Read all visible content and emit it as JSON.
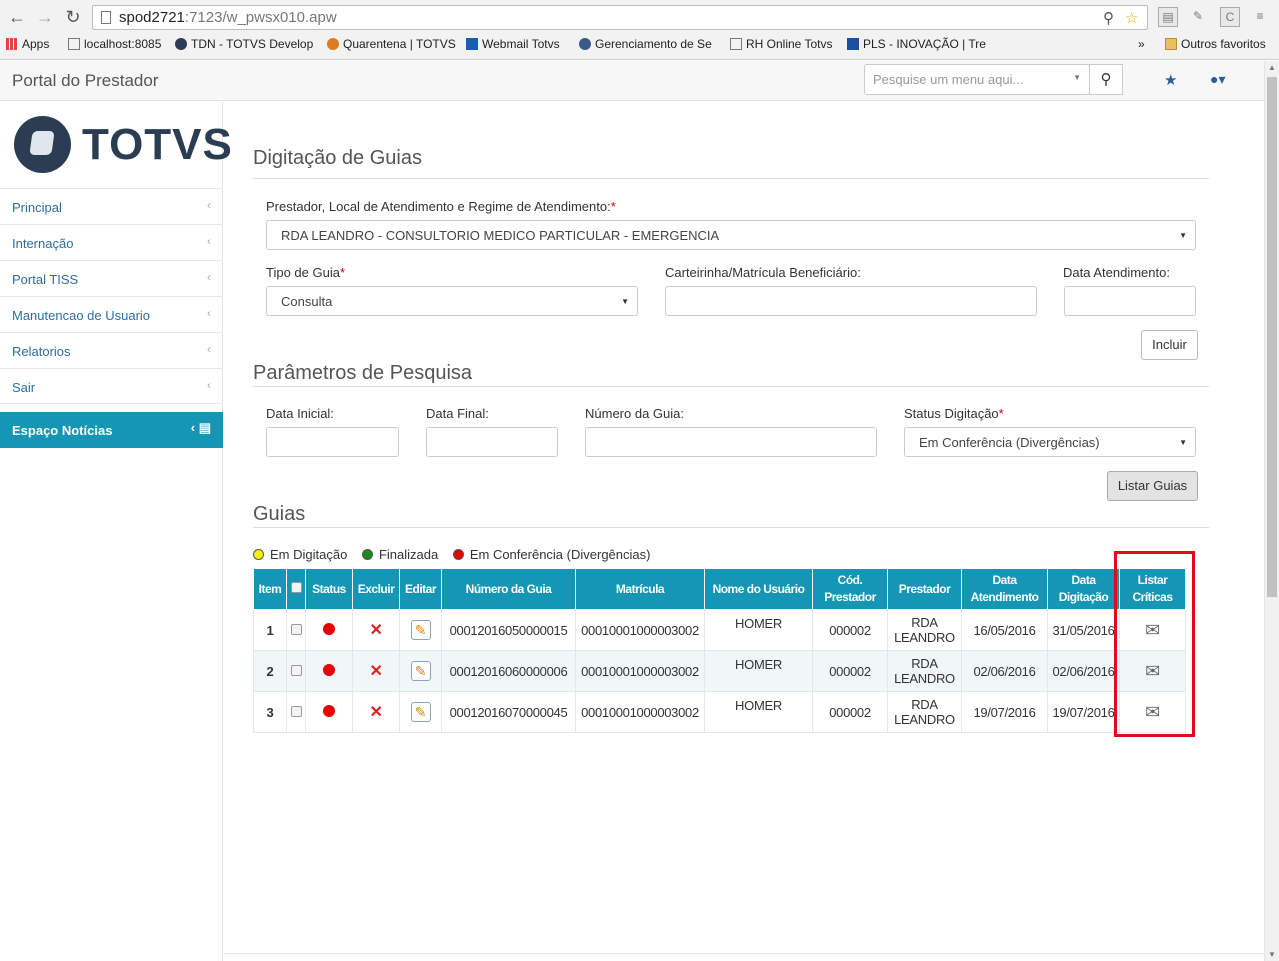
{
  "browser": {
    "url_host": "spod2721",
    "url_rest": ":7123/w_pwsx010.apw",
    "bookmarks": [
      "Apps",
      "localhost:8085",
      "TDN - TOTVS Develop",
      "Quarentena | TOTVS",
      "Webmail Totvs",
      "Gerenciamento de Se",
      "RH Online Totvs",
      "PLS - INOVAÇÃO | Tre",
      "»",
      "Outros favoritos"
    ]
  },
  "header": {
    "brand": "Portal do Prestador",
    "search_placeholder": "Pesquise um menu aqui..."
  },
  "sidebar": {
    "logo_text": "TOTVS",
    "items": [
      "Principal",
      "Internação",
      "Portal TISS",
      "Manutencao de Usuario",
      "Relatorios",
      "Sair"
    ],
    "news_label": "Espaço Notícias"
  },
  "form": {
    "title": "Digitação de Guias",
    "prestador_label": "Prestador, Local de Atendimento e Regime de Atendimento:",
    "prestador_value": "RDA LEANDRO - CONSULTORIO MEDICO PARTICULAR - EMERGENCIA",
    "tipo_label": "Tipo de Guia",
    "tipo_value": "Consulta",
    "carteirinha_label": "Carteirinha/Matrícula Beneficiário:",
    "carteirinha_value": "",
    "data_atend_label": "Data Atendimento:",
    "data_atend_value": "",
    "incluir_label": "Incluir",
    "required_mark": "*"
  },
  "search": {
    "title": "Parâmetros de Pesquisa",
    "data_inicial_label": "Data Inicial:",
    "data_final_label": "Data Final:",
    "numero_label": "Número da Guia:",
    "status_label": "Status Digitação",
    "status_value": "Em Conferência (Divergências)",
    "listar_label": "Listar Guias"
  },
  "guias": {
    "title": "Guias",
    "legend": [
      {
        "label": "Em Digitação",
        "color": "#f5f500"
      },
      {
        "label": "Finalizada",
        "color": "#1a8a1a"
      },
      {
        "label": "Em Conferência (Divergências)",
        "color": "#e60000"
      }
    ],
    "columns": [
      "Item",
      "Status",
      "Excluir",
      "Editar",
      "Número da Guia",
      "Matrícula",
      "Nome do Usuário",
      "Cód. Prestador",
      "Prestador",
      "Data Atendimento",
      "Data Digitação",
      "Listar Críticas"
    ],
    "rows": [
      {
        "item": "1",
        "numero": "00012016050000015",
        "matricula": "00010001000003002",
        "nome": "HOMER",
        "cod": "000002",
        "prestador": "RDA LEANDRO",
        "data_atend": "16/05/2016",
        "data_dig": "31/05/2016"
      },
      {
        "item": "2",
        "numero": "00012016060000006",
        "matricula": "00010001000003002",
        "nome": "HOMER",
        "cod": "000002",
        "prestador": "RDA LEANDRO",
        "data_atend": "02/06/2016",
        "data_dig": "02/06/2016"
      },
      {
        "item": "3",
        "numero": "00012016070000045",
        "matricula": "00010001000003002",
        "nome": "HOMER",
        "cod": "000002",
        "prestador": "RDA LEANDRO",
        "data_atend": "19/07/2016",
        "data_dig": "19/07/2016"
      }
    ]
  },
  "colors": {
    "accent": "#1496b4",
    "highlight": "#e00b1c",
    "link": "#2c6ea0"
  }
}
